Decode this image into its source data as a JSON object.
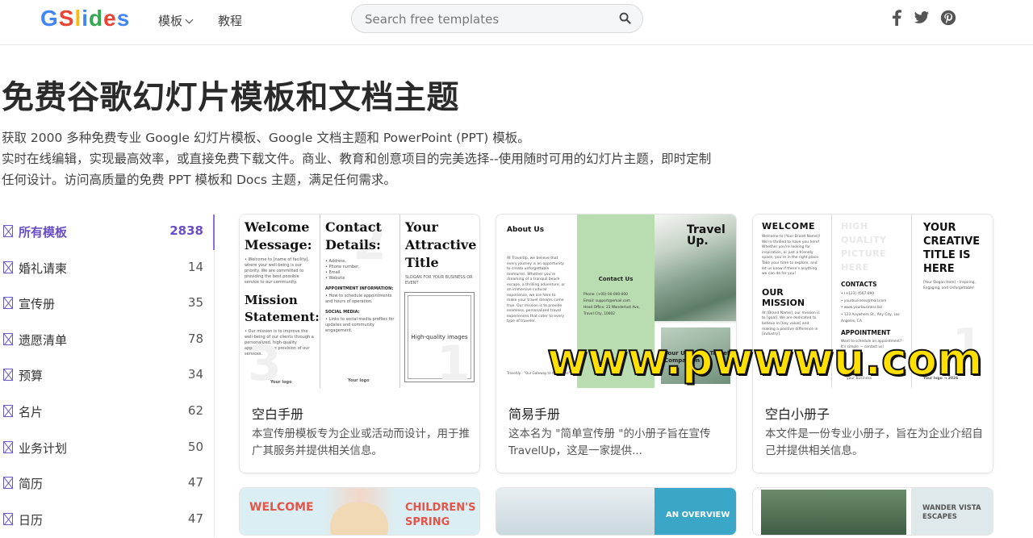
{
  "header": {
    "logo_letters": [
      {
        "ch": "G",
        "color": "#4285F4"
      },
      {
        "ch": "S",
        "color": "#EA4335"
      },
      {
        "ch": "l",
        "color": "#FBBC05"
      },
      {
        "ch": "i",
        "color": "#4285F4"
      },
      {
        "ch": "d",
        "color": "#34A853"
      },
      {
        "ch": "e",
        "color": "#EA4335"
      },
      {
        "ch": "s",
        "color": "#4285F4"
      }
    ],
    "nav_templates": "模板",
    "nav_tutorials": "教程",
    "search_placeholder": "Search free templates",
    "social_icons": [
      "facebook-icon",
      "twitter-icon",
      "pinterest-icon"
    ]
  },
  "hero": {
    "title": "免费谷歌幻灯片模板和文档主题",
    "intro_lines": [
      "获取 2000 多种免费专业 Google 幻灯片模板、Google 文档主题和 PowerPoint (PPT) 模板。",
      "实时在线编辑，实现最高效率，或直接免费下载文件。商业、教育和创意项目的完美选择--使用随时可用的幻灯片主题，即时定制",
      "任何设计。访问高质量的免费 PPT 模板和 Docs 主题，满足任何需求。"
    ]
  },
  "sidebar": {
    "items": [
      {
        "label": "所有模板",
        "count": "2838",
        "active": true
      },
      {
        "label": "婚礼请柬",
        "count": "14"
      },
      {
        "label": "宣传册",
        "count": "35"
      },
      {
        "label": "遗愿清单",
        "count": "78"
      },
      {
        "label": "预算",
        "count": "34"
      },
      {
        "label": "名片",
        "count": "62"
      },
      {
        "label": "业务计划",
        "count": "50"
      },
      {
        "label": "简历",
        "count": "47"
      },
      {
        "label": "日历",
        "count": "47"
      }
    ]
  },
  "cards": [
    {
      "title": "空白手册",
      "desc": "本宣传册模板专为企业或活动而设计，用于推广其服务并提供相关信息。",
      "thumb": {
        "p1_title1": "Welcome Message:",
        "p1_text1": "• Welcome to [name of facility], where your well-being is our priority. We are committed to providing the best possible service to our community.",
        "p1_title2": "Mission Statement:",
        "p1_text2": "• Our mission is to improve the well-being of our clients through a personalized, high-quality approach to the provision of our services.",
        "p1_logo": "Your logo",
        "p2_title": "Contact Details:",
        "p2_list": "• Address,\n• Phone number,\n• Email\n• Website",
        "p2_h1": "APPOINTMENT INFORMATION:",
        "p2_t1": "• How to schedule appointments and hours of operation.",
        "p2_h2": "SOCIAL MEDIA:",
        "p2_t2": "• Links to social media profiles for updates and community engagement.",
        "p2_logo": "Your logo",
        "p3_title": "Your Attractive Title",
        "p3_slogan": "SLOGAN FOR YOUR BUSINESS OR EVENT",
        "p3_img": "High-quality images"
      }
    },
    {
      "title": "简易手册",
      "desc": "这本名为 \"简单宣传册 \"的小册子旨在宣传 TravelUp，这是一家提供...",
      "thumb": {
        "p1_title": "About Us",
        "p1_text": "At TravelUp, we believe that every journey is an opportunity to create unforgettable memories. Whether you're dreaming of a tranquil beach escape, a thrilling adventure, or an immersive cultural experience, we are here to make your travel dreams come true. Our mission is to provide seamless, personalized travel experiences that cater to every type of traveler.",
        "p1_foot": "TravelUp · \"Our Gateway to Adventure\"",
        "p2_title": "Contact Us",
        "p2_text": "Phone: (+00) 00-000-000\nEmail: support@email.com\nHead Office: 23 Wanderlust Ave, Travel City, 10002",
        "p3_title": "Travel Up.",
        "p3_sub": "Your Ultimate Travel Companion"
      }
    },
    {
      "title": "空白小册子",
      "desc": "本文件是一份专业小册子，旨在为企业介绍自己并提供相关信息。",
      "thumb": {
        "p1_title": "WELCOME",
        "p1_text": "Welcome to [Your Brand Name]! We're thrilled to have you here! Whether you're looking for inspiration, or just a friendly space, you're in the right place. Take your time to explore, and let us know if there's anything we can do for you!",
        "p1_h2": "OUR MISSION",
        "p1_text2": "At [Brand Name], our mission is to [goal]. We are dedicated to believe in [key value] and making a positive difference in [industry].",
        "p2_ghost": "HIGH QUALITY PICTURE HERE",
        "p2_h": "CONTACTS",
        "p2_list": "• (+123) 4567-890\n• yourbusiness@mail.com\n• www.yourbusiness.biz\n• 123 Anywhere St., Any City, Los Angeles, CA",
        "p2_h2": "APPOINTMENT",
        "p2_text2": "Want to schedule an appointment? It's simple — contact us!",
        "p2_foot": "your business",
        "p3_title": "YOUR CREATIVE TITLE IS HERE",
        "p3_slogan": "[Your Slogan Here] – Inspiring, Engaging, and Unforgettable!",
        "p3_foot": "Your logo → 2026"
      }
    }
  ],
  "bottom_cards": [
    {
      "left": "WELCOME",
      "right": "CHILDREN'S SPRING"
    },
    {
      "right": "AN OVERVIEW"
    },
    {
      "right": "WANDER VISTA ESCAPES"
    }
  ],
  "watermark": "www.pwwwu.com"
}
